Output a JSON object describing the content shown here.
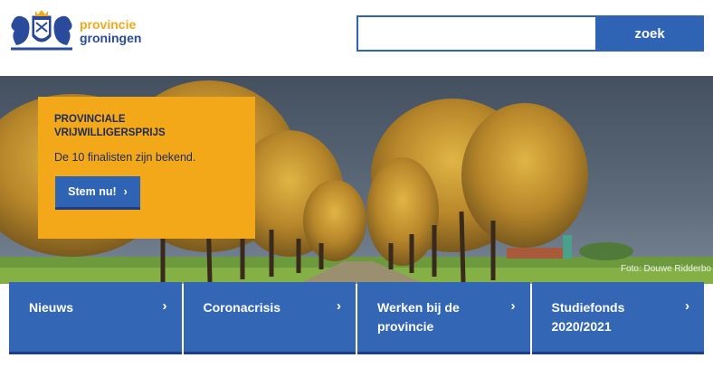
{
  "header": {
    "logo": {
      "line1": "provincie",
      "line2": "groningen"
    },
    "search": {
      "placeholder": "",
      "value": "",
      "button_label": "zoek"
    }
  },
  "hero": {
    "caption": "Foto: Douwe Ridderbo",
    "promo": {
      "title": "PROVINCIALE VRIJWILLIGERSPRIJS",
      "subtitle": "De 10 finalisten zijn bekend.",
      "button_label": "Stem nu!",
      "button_icon": "chevron-right-icon"
    }
  },
  "tiles": [
    {
      "label": "Nieuws",
      "icon": "chevron-right-icon"
    },
    {
      "label": "Coronacrisis",
      "icon": "chevron-right-icon"
    },
    {
      "label": "Werken bij de provincie",
      "icon": "chevron-right-icon"
    },
    {
      "label": "Studiefonds 2020/2021",
      "icon": "chevron-right-icon"
    }
  ],
  "colors": {
    "brand_blue": "#2f64b4",
    "brand_orange": "#f2a818",
    "navy": "#1d2a5a"
  }
}
